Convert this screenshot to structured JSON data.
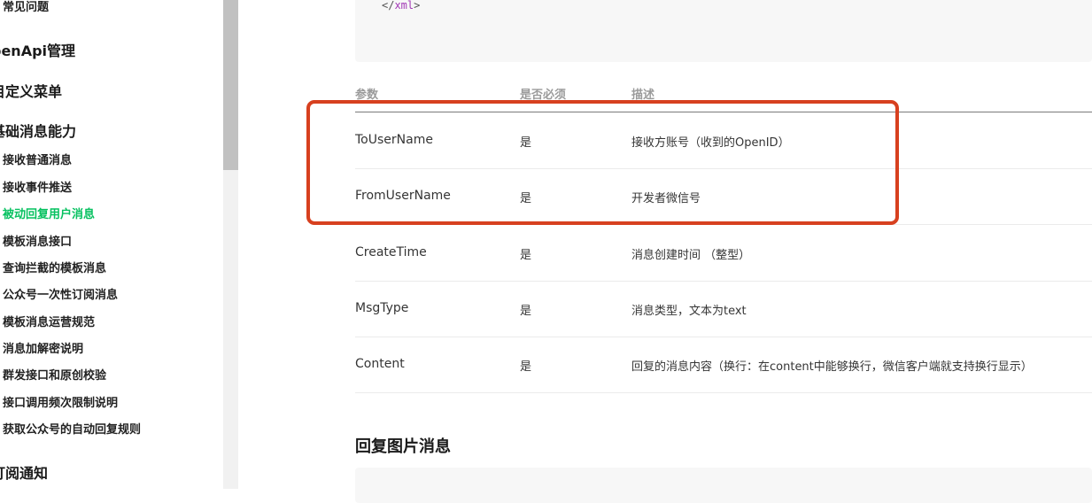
{
  "sidebar": {
    "items": [
      {
        "label": "常见问题",
        "level": "sub",
        "active": false
      },
      {
        "label": "penApi管理",
        "level": "group",
        "active": false
      },
      {
        "label": "目定义菜单",
        "level": "group",
        "active": false
      },
      {
        "label": "基础消息能力",
        "level": "group",
        "active": false
      },
      {
        "label": "接收普通消息",
        "level": "sub",
        "active": false
      },
      {
        "label": "接收事件推送",
        "level": "sub",
        "active": false
      },
      {
        "label": "被动回复用户消息",
        "level": "sub",
        "active": true
      },
      {
        "label": "模板消息接口",
        "level": "sub",
        "active": false
      },
      {
        "label": "查询拦截的模板消息",
        "level": "sub",
        "active": false
      },
      {
        "label": "公众号一次性订阅消息",
        "level": "sub",
        "active": false
      },
      {
        "label": "模板消息运营规范",
        "level": "sub",
        "active": false
      },
      {
        "label": "消息加解密说明",
        "level": "sub",
        "active": false
      },
      {
        "label": "群发接口和原创校验",
        "level": "sub",
        "active": false
      },
      {
        "label": "接口调用频次限制说明",
        "level": "sub",
        "active": false
      },
      {
        "label": "获取公众号的自动回复规则",
        "level": "sub",
        "active": false
      },
      {
        "label": "订阅通知",
        "level": "group",
        "active": false
      }
    ],
    "active_color": "#07c160"
  },
  "code": {
    "close_open": "</",
    "close_tag": "xml",
    "close_end": ">"
  },
  "table": {
    "headers": [
      "参数",
      "是否必须",
      "描述"
    ],
    "rows": [
      {
        "param": "ToUserName",
        "required": "是",
        "desc": "接收方账号（收到的OpenID）"
      },
      {
        "param": "FromUserName",
        "required": "是",
        "desc": "开发者微信号"
      },
      {
        "param": "CreateTime",
        "required": "是",
        "desc": "消息创建时间 （整型）"
      },
      {
        "param": "MsgType",
        "required": "是",
        "desc": "消息类型，文本为text"
      },
      {
        "param": "Content",
        "required": "是",
        "desc": "回复的消息内容（换行：在content中能够换行，微信客户端就支持换行显示）"
      }
    ]
  },
  "section": {
    "title": "回复图片消息"
  },
  "highlight_color": "#d7401f"
}
